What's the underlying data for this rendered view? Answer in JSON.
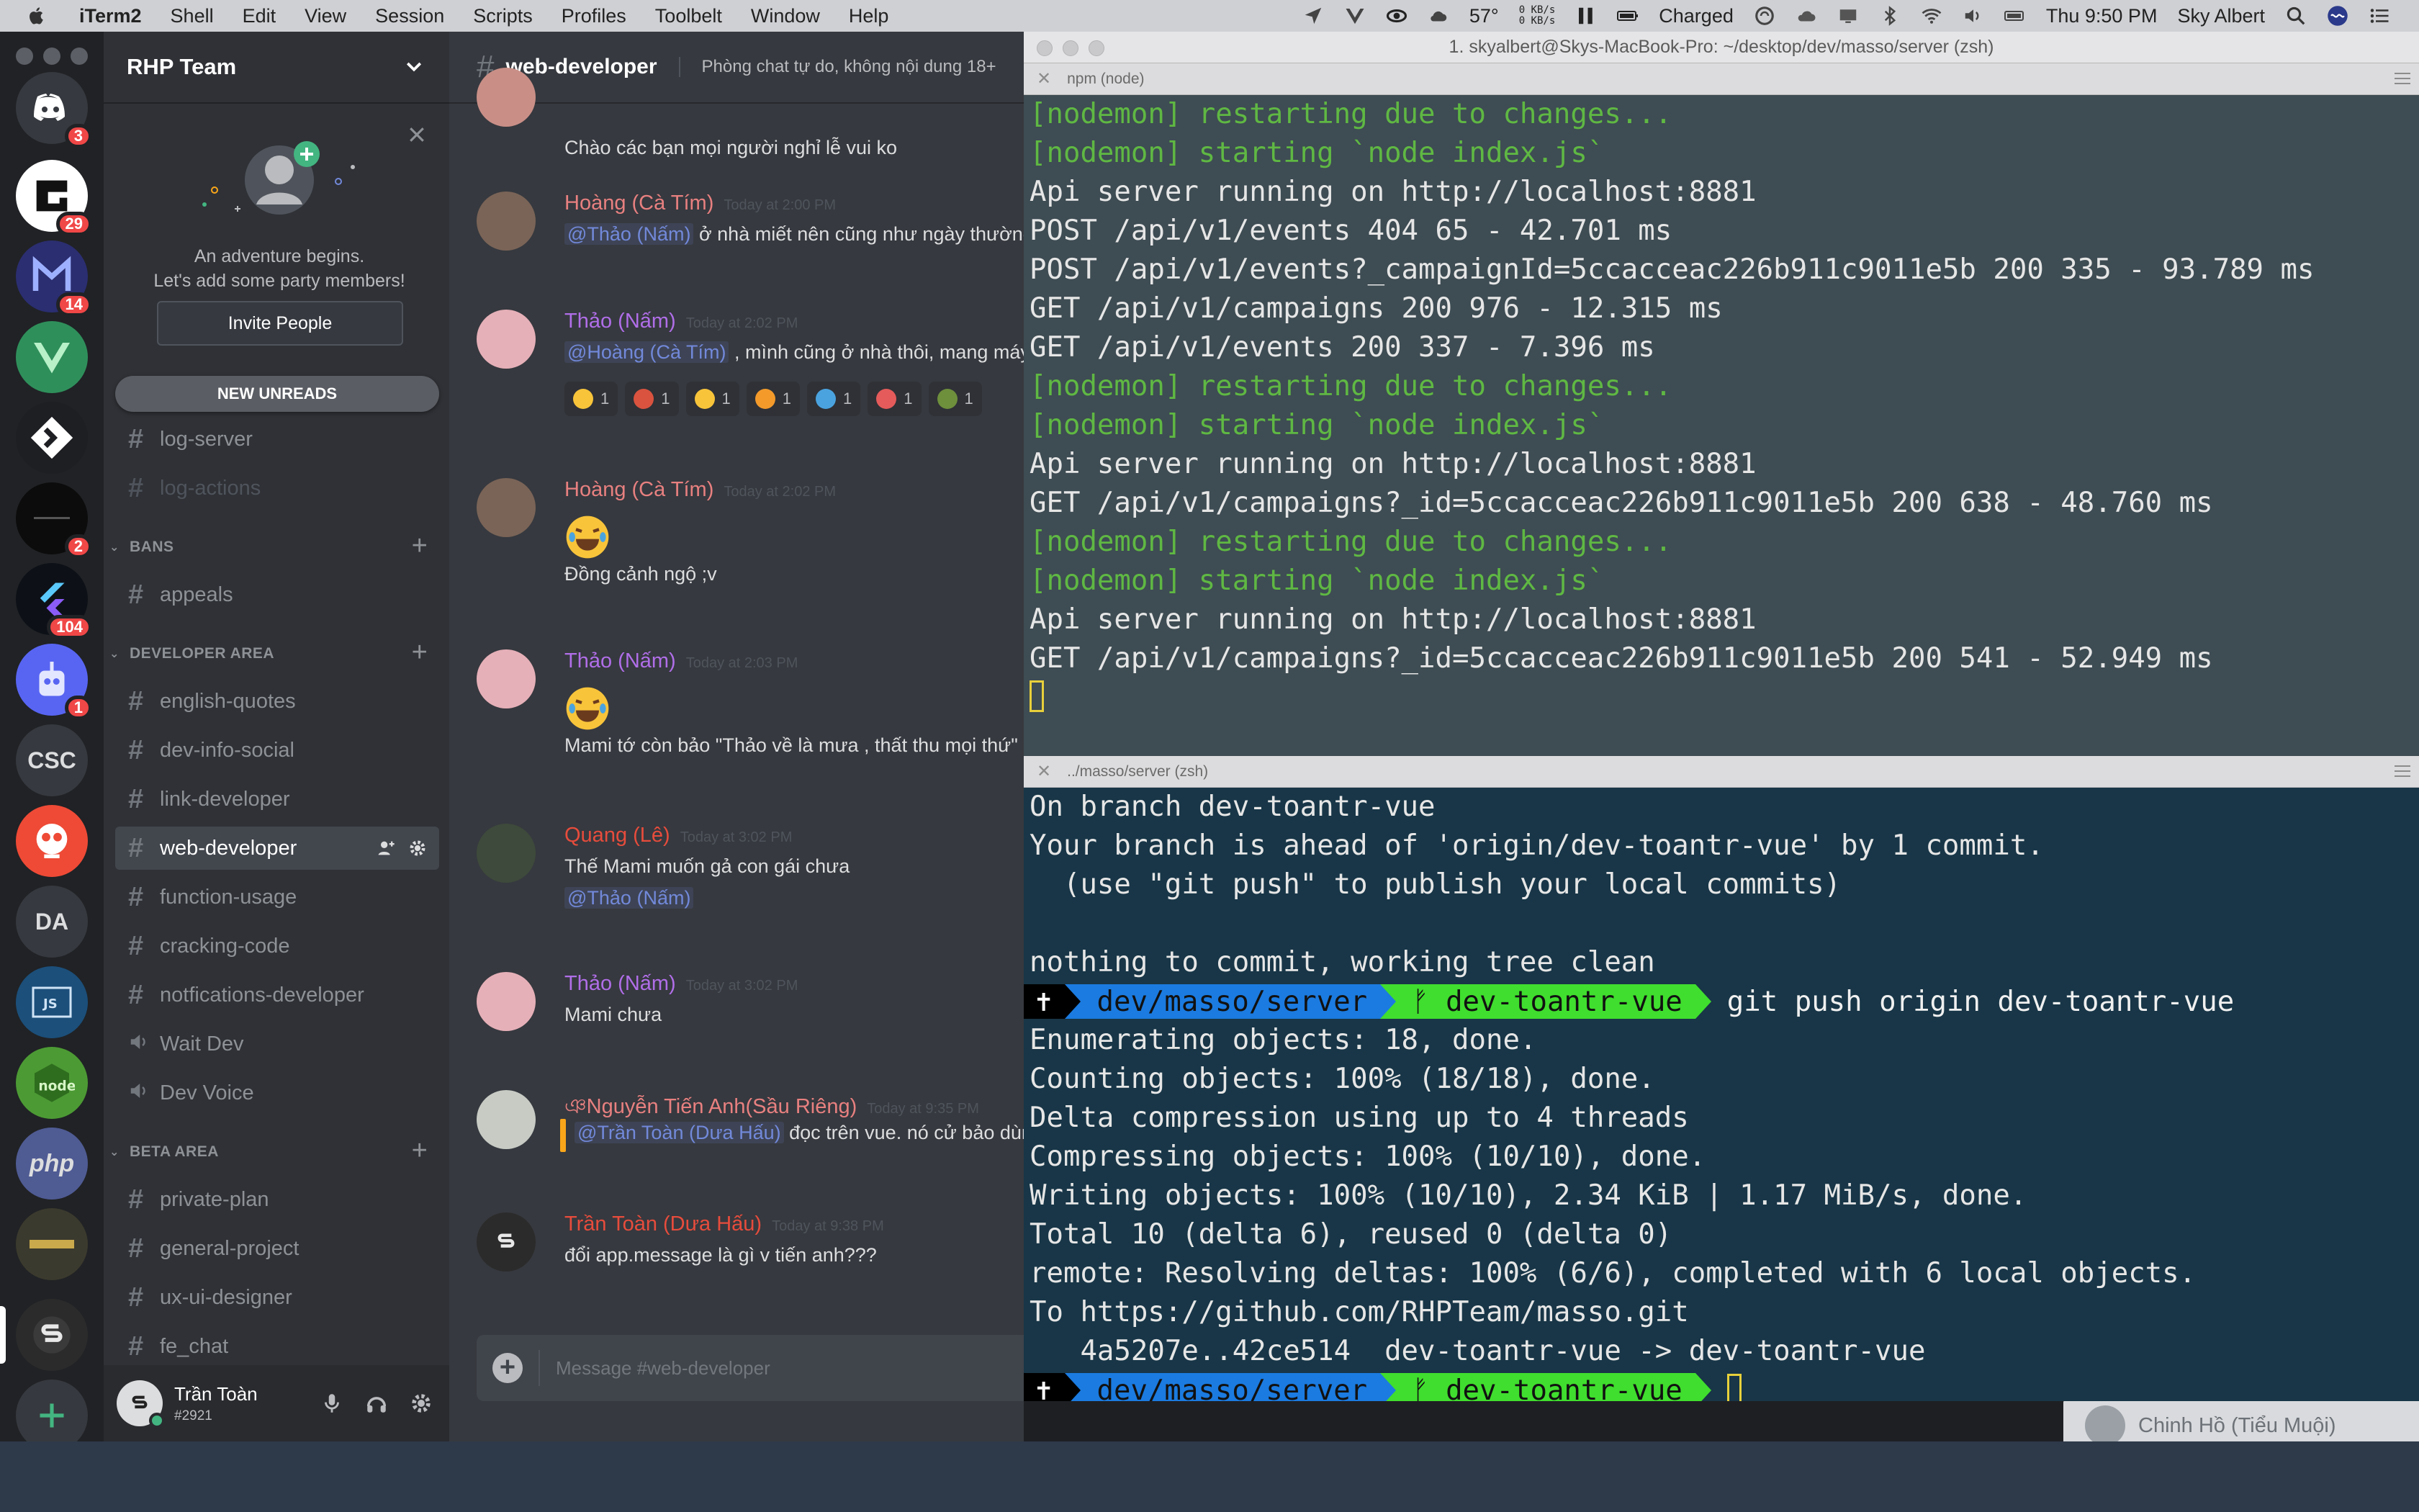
{
  "menubar": {
    "app": "iTerm2",
    "items": [
      "Shell",
      "Edit",
      "View",
      "Session",
      "Scripts",
      "Profiles",
      "Toolbelt",
      "Window",
      "Help"
    ],
    "temperature": "57°",
    "net_up": "0 KB/s",
    "net_down": "0 KB/s",
    "battery": "Charged",
    "clock": "Thu 9:50 PM",
    "user": "Sky Albert"
  },
  "discord": {
    "servers": [
      {
        "name": "discord-home",
        "badge": "3",
        "color": "#36393f",
        "label": ""
      },
      {
        "name": "server-g",
        "badge": "29",
        "color": "#ffffff",
        "label": ""
      },
      {
        "name": "server-m",
        "badge": "14",
        "color": "#2b2e70",
        "label": ""
      },
      {
        "name": "server-vue",
        "badge": "",
        "color": "#2f8f5b",
        "label": ""
      },
      {
        "name": "server-diamond",
        "badge": "",
        "color": "#1e1f23",
        "label": ""
      },
      {
        "name": "server-dark",
        "badge": "2",
        "color": "#0c0c0c",
        "label": ""
      },
      {
        "name": "server-flutter",
        "badge": "104",
        "color": "#0d1117",
        "label": ""
      },
      {
        "name": "server-bot",
        "badge": "1",
        "color": "#5865f2",
        "label": ""
      },
      {
        "name": "server-csc",
        "badge": "",
        "color": "#36393f",
        "label": "CSC"
      },
      {
        "name": "server-askfm",
        "badge": "",
        "color": "#ee4a36",
        "label": ""
      },
      {
        "name": "server-da",
        "badge": "",
        "color": "#36393f",
        "label": "DA"
      },
      {
        "name": "server-js",
        "badge": "",
        "color": "#1c4f7a",
        "label": ""
      },
      {
        "name": "server-node",
        "badge": "",
        "color": "#4c9a34",
        "label": ""
      },
      {
        "name": "server-php",
        "badge": "",
        "color": "#4f5b93",
        "label": "php"
      },
      {
        "name": "server-pubg",
        "badge": "",
        "color": "#3b3a2e",
        "label": ""
      },
      {
        "name": "server-rhp",
        "badge": "",
        "color": "#2b2b2b",
        "label": ""
      }
    ],
    "guild": {
      "name": "RHP Team",
      "invite_line1": "An adventure begins.",
      "invite_line2": "Let's add some party members!",
      "invite_button": "Invite People",
      "new_unreads": "NEW UNREADS"
    },
    "channels_top": [
      {
        "name": "log-server",
        "state": "normal"
      },
      {
        "name": "log-actions",
        "state": "muted"
      }
    ],
    "categories": {
      "bans": {
        "label": "BANS",
        "channels": [
          "appeals"
        ]
      },
      "developer": {
        "label": "DEVELOPER AREA",
        "channels": [
          "english-quotes",
          "dev-info-social",
          "link-developer",
          "web-developer",
          "function-usage",
          "cracking-code",
          "notfications-developer"
        ]
      },
      "voice": [
        "Wait Dev",
        "Dev Voice"
      ],
      "beta": {
        "label": "BETA AREA",
        "channels": [
          "private-plan",
          "general-project",
          "ux-ui-designer",
          "fe_chat"
        ]
      }
    },
    "user": {
      "name": "Trần Toàn",
      "tag": "#2921"
    },
    "chat": {
      "channel": "web-developer",
      "topic": "Phòng chat tự do, không nội dung 18+",
      "partial_top": "Chào các bạn mọi người nghỉ lễ vui ko",
      "messages": [
        {
          "author": "Hoàng (Cà Tím)",
          "color": "#e88080",
          "time": "Today at 2:00 PM",
          "mention": "@Thảo (Nấm)",
          "text": " ở nhà miết nên cũng như ngày thường"
        },
        {
          "author": "Thảo (Nấm)",
          "color": "#b06ee8",
          "time": "Today at 2:02 PM",
          "mention": "@Hoàng (Cà Tím)",
          "text": " , mình cũng ở nhà thôi, mang máy"
        },
        {
          "author": "Hoàng (Cà Tím)",
          "color": "#e88080",
          "time": "Today at 2:02 PM",
          "text": "Đồng cảnh ngộ ;v"
        },
        {
          "author": "Thảo (Nấm)",
          "color": "#b06ee8",
          "time": "Today at 2:03 PM",
          "text": "Mami tớ còn bảo \"Thảo về là mưa , thất thu mọi thứ\""
        },
        {
          "author": "Quang (Lê)",
          "color": "#e74c3c",
          "time": "Today at 3:02 PM",
          "text": "Thế Mami muốn gả con gái chưa",
          "mention": "@Thảo (Nấm)"
        },
        {
          "author": "Thảo (Nấm)",
          "color": "#b06ee8",
          "time": "Today at 3:02 PM",
          "text": "Mami chưa"
        },
        {
          "author": "ঞNguyễn Tiến Anh(Sầu Riêng)",
          "color": "#e88080",
          "time": "Today at 9:35 PM",
          "mention": "@Trần Toàn (Dưa Hấu)",
          "text": " đọc trên vue. nó cử bảo dùng"
        },
        {
          "author": "Trần Toàn (Dưa Hấu)",
          "color": "#e74c3c",
          "time": "Today at 9:38 PM",
          "text": "đổi app.message là gì v tiến anh???"
        }
      ],
      "reactions": [
        "1",
        "1",
        "1",
        "1",
        "1",
        "1",
        "1"
      ],
      "composer_placeholder": "Message #web-developer"
    },
    "dm_peek": "Chinh Hồ (Tiểu Muội)"
  },
  "iterm": {
    "window_title": "1. skyalbert@Skys-MacBook-Pro: ~/desktop/dev/masso/server (zsh)",
    "pane1_title": "npm (node)",
    "pane1_lines": [
      {
        "t": "[nodemon] restarting due to changes...",
        "c": "green"
      },
      {
        "t": "[nodemon] starting `node index.js`",
        "c": "green"
      },
      {
        "t": "Api server running on http://localhost:8881",
        "c": ""
      },
      {
        "t": "POST /api/v1/events 404 65 - 42.701 ms",
        "c": ""
      },
      {
        "t": "POST /api/v1/events?_campaignId=5ccacceac226b911c9011e5b 200 335 - 93.789 ms",
        "c": ""
      },
      {
        "t": "GET /api/v1/campaigns 200 976 - 12.315 ms",
        "c": ""
      },
      {
        "t": "GET /api/v1/events 200 337 - 7.396 ms",
        "c": ""
      },
      {
        "t": "[nodemon] restarting due to changes...",
        "c": "green"
      },
      {
        "t": "[nodemon] starting `node index.js`",
        "c": "green"
      },
      {
        "t": "Api server running on http://localhost:8881",
        "c": ""
      },
      {
        "t": "GET /api/v1/campaigns?_id=5ccacceac226b911c9011e5b 200 638 - 48.760 ms",
        "c": ""
      },
      {
        "t": "[nodemon] restarting due to changes...",
        "c": "green"
      },
      {
        "t": "[nodemon] starting `node index.js`",
        "c": "green"
      },
      {
        "t": "Api server running on http://localhost:8881",
        "c": ""
      },
      {
        "t": "GET /api/v1/campaigns?_id=5ccacceac226b911c9011e5b 200 541 - 52.949 ms",
        "c": ""
      }
    ],
    "pane2_title": "../masso/server (zsh)",
    "pane2_lines_a": [
      "On branch dev-toantr-vue",
      "Your branch is ahead of 'origin/dev-toantr-vue' by 1 commit.",
      "  (use \"git push\" to publish your local commits)",
      "",
      "nothing to commit, working tree clean"
    ],
    "prompt": {
      "path": "dev/masso/server",
      "branch": "dev-toantr-vue",
      "command": "git push origin dev-toantr-vue"
    },
    "pane2_lines_b": [
      "Enumerating objects: 18, done.",
      "Counting objects: 100% (18/18), done.",
      "Delta compression using up to 4 threads",
      "Compressing objects: 100% (10/10), done.",
      "Writing objects: 100% (10/10), 2.34 KiB | 1.17 MiB/s, done.",
      "Total 10 (delta 6), reused 0 (delta 0)",
      "remote: Resolving deltas: 100% (6/6), completed with 6 local objects.",
      "To https://github.com/RHPTeam/masso.git",
      "   4a5207e..42ce514  dev-toantr-vue -> dev-toantr-vue"
    ]
  }
}
